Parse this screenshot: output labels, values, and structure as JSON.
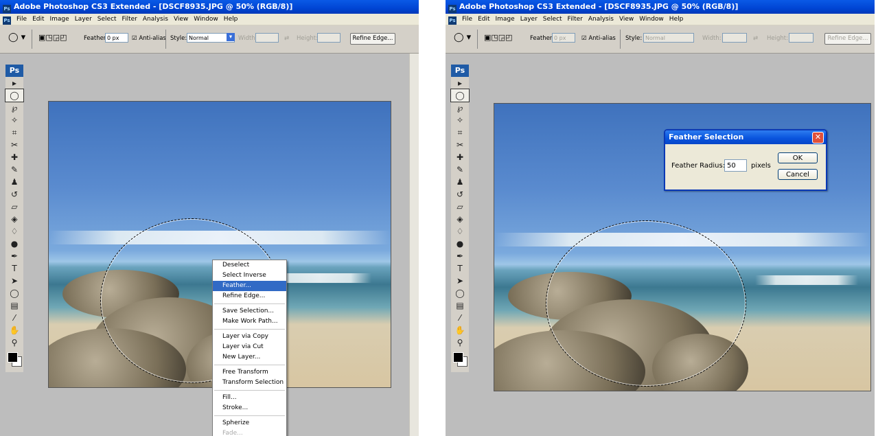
{
  "app": {
    "title": "Adobe Photoshop CS3 Extended - [DSCF8935.JPG @ 50% (RGB/8)]",
    "icon_text": "Ps"
  },
  "menu": [
    "File",
    "Edit",
    "Image",
    "Layer",
    "Select",
    "Filter",
    "Analysis",
    "View",
    "Window",
    "Help"
  ],
  "options": {
    "feather_label": "Feather:",
    "feather_value": "0 px",
    "antialias_label": "Anti-alias",
    "style_label": "Style:",
    "style_value": "Normal",
    "width_label": "Width:",
    "height_label": "Height:",
    "refine_edge_label": "Refine Edge..."
  },
  "toolbox": {
    "logo": "Ps",
    "tools": [
      {
        "name": "move-tool-icon",
        "glyph": "▸"
      },
      {
        "name": "elliptical-marquee-icon",
        "glyph": "◯",
        "active": true
      },
      {
        "name": "lasso-icon",
        "glyph": "℘"
      },
      {
        "name": "magic-wand-icon",
        "glyph": "✧"
      },
      {
        "name": "crop-icon",
        "glyph": "⌗"
      },
      {
        "name": "slice-icon",
        "glyph": "✂"
      },
      {
        "name": "healing-brush-icon",
        "glyph": "✚"
      },
      {
        "name": "brush-icon",
        "glyph": "✎"
      },
      {
        "name": "clone-stamp-icon",
        "glyph": "♟"
      },
      {
        "name": "history-brush-icon",
        "glyph": "↺"
      },
      {
        "name": "eraser-icon",
        "glyph": "▱"
      },
      {
        "name": "paint-bucket-icon",
        "glyph": "◈"
      },
      {
        "name": "blur-icon",
        "glyph": "♢"
      },
      {
        "name": "dodge-icon",
        "glyph": "●"
      },
      {
        "name": "pen-icon",
        "glyph": "✒"
      },
      {
        "name": "type-icon",
        "glyph": "T"
      },
      {
        "name": "path-selection-icon",
        "glyph": "➤"
      },
      {
        "name": "ellipse-shape-icon",
        "glyph": "◯"
      },
      {
        "name": "notes-icon",
        "glyph": "▤"
      },
      {
        "name": "eyedropper-icon",
        "glyph": "⁄"
      },
      {
        "name": "hand-icon",
        "glyph": "✋"
      },
      {
        "name": "zoom-icon",
        "glyph": "⚲"
      }
    ]
  },
  "context_menu": {
    "items": [
      {
        "label": "Deselect"
      },
      {
        "label": "Select Inverse"
      },
      {
        "label": "Feather...",
        "highlighted": true
      },
      {
        "label": "Refine Edge..."
      },
      {
        "divider": true
      },
      {
        "label": "Save Selection..."
      },
      {
        "label": "Make Work Path..."
      },
      {
        "divider": true
      },
      {
        "label": "Layer via Copy"
      },
      {
        "label": "Layer via Cut"
      },
      {
        "label": "New Layer..."
      },
      {
        "divider": true
      },
      {
        "label": "Free Transform"
      },
      {
        "label": "Transform Selection"
      },
      {
        "divider": true
      },
      {
        "label": "Fill..."
      },
      {
        "label": "Stroke..."
      },
      {
        "divider": true
      },
      {
        "label": "Spherize"
      },
      {
        "label": "Fade...",
        "disabled": true
      }
    ]
  },
  "dialog": {
    "title": "Feather Selection",
    "radius_label": "Feather Radius:",
    "radius_value": "50",
    "unit": "pixels",
    "ok": "OK",
    "cancel": "Cancel"
  },
  "colors": {
    "title_bar": "#0045d4",
    "menu_highlight": "#316ac5",
    "canvas_bg": "#bdbdbd",
    "dialog_border": "#0a39b6"
  }
}
